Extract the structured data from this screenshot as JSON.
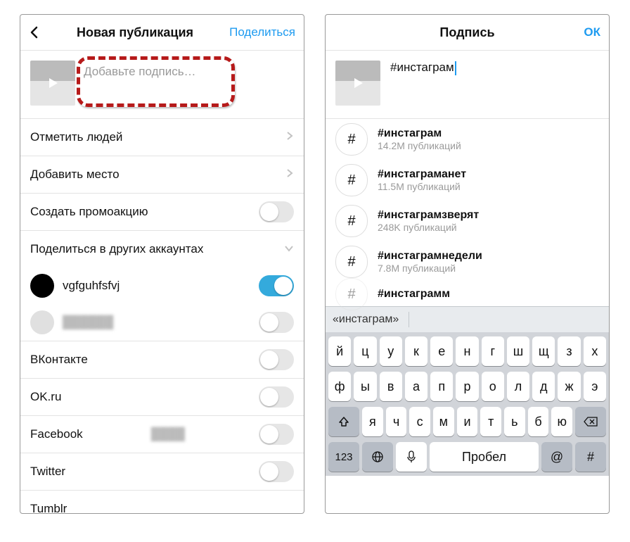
{
  "left": {
    "header_title": "Новая публикация",
    "header_action": "Поделиться",
    "caption_placeholder": "Добавьте подпись…",
    "rows": {
      "tag_people": "Отметить людей",
      "add_location": "Добавить место",
      "promo": "Создать промоакцию",
      "share_accounts": "Поделиться в других аккаунтах",
      "account1": "vgfguhfsfvj",
      "account2_blur": "unknown"
    },
    "networks": [
      "ВКонтакте",
      "OK.ru",
      "Facebook",
      "Twitter",
      "Tumblr"
    ]
  },
  "right": {
    "header_title": "Подпись",
    "header_action": "ОК",
    "caption_text": "#инстаграм",
    "hashtags": [
      {
        "tag": "#инстаграм",
        "count": "14.2M публикаций"
      },
      {
        "tag": "#инстаграманет",
        "count": "11.5M публикаций"
      },
      {
        "tag": "#инстаграмзверят",
        "count": "248K публикаций"
      },
      {
        "tag": "#инстаграмнедели",
        "count": "7.8M публикаций"
      },
      {
        "tag": "#инстаграмм",
        "count": ""
      }
    ],
    "suggest": "«инстаграм»",
    "kbd": {
      "r1": [
        "й",
        "ц",
        "у",
        "к",
        "е",
        "н",
        "г",
        "ш",
        "щ",
        "з",
        "х"
      ],
      "r2": [
        "ф",
        "ы",
        "в",
        "а",
        "п",
        "р",
        "о",
        "л",
        "д",
        "ж",
        "э"
      ],
      "r3": [
        "я",
        "ч",
        "с",
        "м",
        "и",
        "т",
        "ь",
        "б",
        "ю"
      ],
      "space": "Пробел",
      "num": "123"
    }
  }
}
